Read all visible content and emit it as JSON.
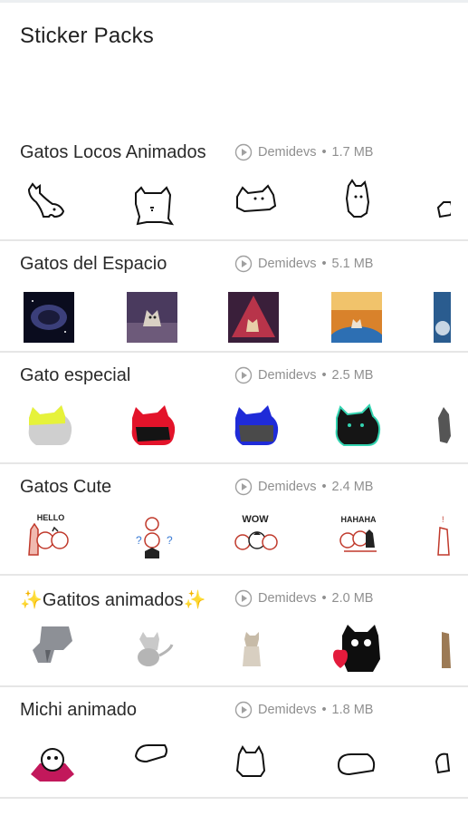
{
  "app": {
    "title": "Sticker Packs"
  },
  "packs": [
    {
      "name": "Gatos Locos Animados",
      "publisher": "Demidevs",
      "size": "1.7 MB",
      "stickers": [
        "doodle-cat-sticker",
        "doodle-cat-sticker",
        "doodle-cat-sticker",
        "doodle-cat-sticker",
        "doodle-cat-sticker"
      ]
    },
    {
      "name": "Gatos del Espacio",
      "publisher": "Demidevs",
      "size": "5.1 MB",
      "stickers": [
        "space-cat-sticker",
        "space-cat-sticker",
        "space-cat-sticker",
        "space-cat-sticker",
        "space-cat-sticker"
      ]
    },
    {
      "name": "Gato especial",
      "publisher": "Demidevs",
      "size": "2.5 MB",
      "stickers": [
        "colored-cat-sticker",
        "colored-cat-sticker",
        "colored-cat-sticker",
        "colored-cat-sticker",
        "colored-cat-sticker"
      ]
    },
    {
      "name": "Gatos Cute",
      "publisher": "Demidevs",
      "size": "2.4 MB",
      "sticker_texts": [
        "HELLO",
        "",
        "WOW",
        "HAHAHA",
        ""
      ],
      "stickers": [
        "cute-cat-sticker",
        "cute-cat-sticker",
        "cute-cat-sticker",
        "cute-cat-sticker",
        "cute-cat-sticker"
      ]
    },
    {
      "name": "✨Gatitos animados✨",
      "publisher": "Demidevs",
      "size": "2.0 MB",
      "stickers": [
        "kitten-sticker",
        "kitten-sticker",
        "kitten-sticker",
        "kitten-sticker",
        "kitten-sticker"
      ]
    },
    {
      "name": "Michi animado",
      "publisher": "Demidevs",
      "size": "1.8 MB",
      "stickers": [
        "michi-sticker",
        "michi-sticker",
        "michi-sticker",
        "michi-sticker",
        "michi-sticker"
      ]
    }
  ],
  "colors": {
    "divider": "#e6e6e6",
    "meta": "#8f8f8f",
    "title": "#212121"
  }
}
